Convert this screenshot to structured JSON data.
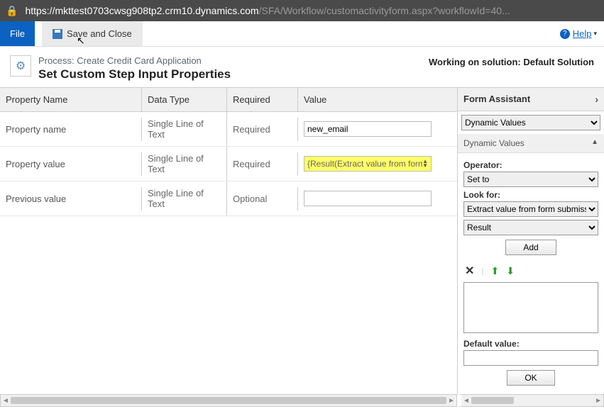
{
  "address_bar": {
    "domain": "https://mkttest0703cwsg908tp2.crm10.dynamics.com",
    "path": "/SFA/Workflow/customactivityform.aspx?workflowId=40..."
  },
  "toolbar": {
    "file_label": "File",
    "save_close_label": "Save and Close",
    "help_label": "Help"
  },
  "header": {
    "process_prefix": "Process: ",
    "process_name": "Create Credit Card Application",
    "title": "Set Custom Step Input Properties",
    "working_on": "Working on solution: Default Solution"
  },
  "grid": {
    "headers": {
      "name": "Property Name",
      "type": "Data Type",
      "required": "Required",
      "value": "Value"
    },
    "rows": [
      {
        "name": "Property name",
        "type": "Single Line of Text",
        "required": "Required",
        "value": "new_email",
        "highlight": false
      },
      {
        "name": "Property value",
        "type": "Single Line of Text",
        "required": "Required",
        "value": "{Result(Extract value from form",
        "highlight": true
      },
      {
        "name": "Previous value",
        "type": "Single Line of Text",
        "required": "Optional",
        "value": "",
        "highlight": false
      }
    ]
  },
  "assistant": {
    "title": "Form Assistant",
    "section_select": "Dynamic Values",
    "section_header": "Dynamic Values",
    "operator_label": "Operator:",
    "operator_value": "Set to",
    "lookfor_label": "Look for:",
    "lookfor_entity": "Extract value from form submission",
    "lookfor_attr": "Result",
    "add_label": "Add",
    "default_label": "Default value:",
    "ok_label": "OK"
  }
}
